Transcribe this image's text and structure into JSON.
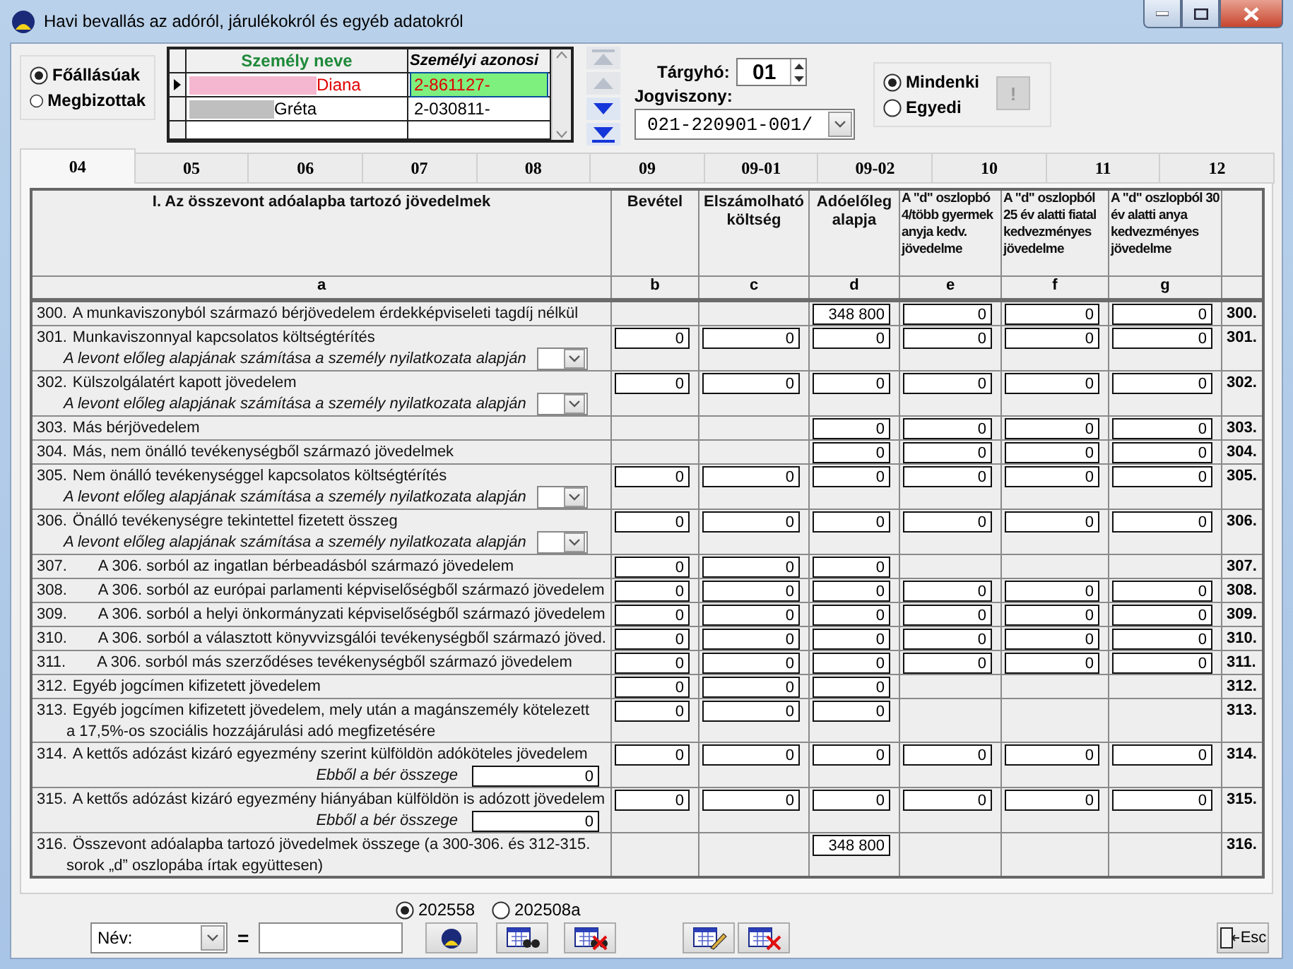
{
  "window": {
    "title": "Havi bevallás az adóról, járulékokról és egyéb adatokról"
  },
  "employment_filter": [
    {
      "label": "Főállásúak",
      "selected": true
    },
    {
      "label": "Megbizottak",
      "selected": false
    }
  ],
  "persons": {
    "columns": [
      "Személy neve",
      "Személyi azonosi"
    ],
    "rows": [
      {
        "name": "Diana",
        "id": "2-861127-",
        "selected": true
      },
      {
        "name": "Gréta",
        "id": "2-030811-",
        "selected": false
      }
    ]
  },
  "navigation": [
    {
      "kind": "first",
      "disabled": true
    },
    {
      "kind": "previous",
      "disabled": true
    },
    {
      "kind": "next",
      "disabled": false
    },
    {
      "kind": "last",
      "disabled": false
    }
  ],
  "period": {
    "label": "Tárgyhó:",
    "value": "01"
  },
  "relation": {
    "label": "Jogviszony:",
    "value": "021-220901-001/"
  },
  "scope": [
    {
      "label": "Mindenki",
      "selected": true
    },
    {
      "label": "Egyedi",
      "selected": false
    }
  ],
  "info_button": {
    "label": "!",
    "disabled": true
  },
  "tabs": [
    {
      "label": "04",
      "selected": true
    },
    {
      "label": "05",
      "selected": false
    },
    {
      "label": "06",
      "selected": false
    },
    {
      "label": "07",
      "selected": false
    },
    {
      "label": "08",
      "selected": false
    },
    {
      "label": "09",
      "selected": false
    },
    {
      "label": "09-01",
      "selected": false
    },
    {
      "label": "09-02",
      "selected": false
    },
    {
      "label": "10",
      "selected": false
    },
    {
      "label": "11",
      "selected": false
    },
    {
      "label": "12",
      "selected": false
    }
  ],
  "table": {
    "columns": [
      {
        "heading": "I. Az összevont adóalapba tartozó jövedelmek",
        "letter": "a"
      },
      {
        "heading": "Bevétel",
        "letter": "b"
      },
      {
        "heading": "Elszámolható költség",
        "letter": "c"
      },
      {
        "heading": "Adóelőleg alapja",
        "letter": "d"
      },
      {
        "heading": "A \"d\" oszlopbó 4/több gyermek anyja kedv. jövedelme",
        "letter": "e"
      },
      {
        "heading": "A \"d\" oszlopból 25 év alatti fiatal kedvezményes jövedelme",
        "letter": "f"
      },
      {
        "heading": "A \"d\" oszlopból 30 év alatti anya kedvezményes jövedelme",
        "letter": "g"
      }
    ],
    "rows": [
      {
        "kind": "main",
        "number": "300.",
        "label": "A munkaviszonyból származó bérjövedelem érdekképviseleti tagdíj nélkül",
        "values": {
          "d": "348 800",
          "e": "0",
          "f": "0",
          "g": "0"
        },
        "end_number": "300."
      },
      {
        "kind": "main",
        "number": "301.",
        "label": "Munkaviszonnyal kapcsolatos költségtérítés",
        "sub": {
          "kind": "dropdown",
          "label": "A levont előleg alapjának számítása a személy nyilatkozata alapján"
        },
        "values": [
          "0",
          "0",
          "0",
          "0",
          "0",
          "0"
        ],
        "end_number": "301."
      },
      {
        "kind": "main",
        "number": "302.",
        "label": "Külszolgálatért kapott jövedelem",
        "sub": {
          "kind": "dropdown",
          "label": "A levont előleg alapjának számítása a személy nyilatkozata alapján"
        },
        "values": [
          "0",
          "0",
          "0",
          "0",
          "0",
          "0"
        ],
        "end_number": "302."
      },
      {
        "kind": "main",
        "number": "303.",
        "label": "Más bérjövedelem",
        "values": {
          "d": "0",
          "e": "0",
          "f": "0",
          "g": "0"
        },
        "end_number": "303."
      },
      {
        "kind": "main",
        "number": "304.",
        "label": "Más, nem önálló tevékenységből származó jövedelmek",
        "values": {
          "d": "0",
          "e": "0",
          "f": "0",
          "g": "0"
        },
        "end_number": "304."
      },
      {
        "kind": "main",
        "number": "305.",
        "label": "Nem önálló tevékenységgel kapcsolatos költségtérítés",
        "sub": {
          "kind": "dropdown",
          "label": "A levont előleg alapjának számítása a személy nyilatkozata alapján"
        },
        "values": [
          "0",
          "0",
          "0",
          "0",
          "0",
          "0"
        ],
        "end_number": "305."
      },
      {
        "kind": "main",
        "number": "306.",
        "label": "Önálló tevékenységre tekintettel fizetett összeg",
        "sub": {
          "kind": "dropdown",
          "label": "A levont előleg alapjának számítása a személy nyilatkozata alapján"
        },
        "values": [
          "0",
          "0",
          "0",
          "0",
          "0",
          "0"
        ],
        "end_number": "306."
      },
      {
        "kind": "detail",
        "number": "307.",
        "label": "A 306. sorból az ingatlan bérbeadásból származó jövedelem",
        "values": {
          "b": "0",
          "c": "0",
          "d": "0"
        },
        "end_number": "307."
      },
      {
        "kind": "detail",
        "number": "308.",
        "label": "A 306. sorból az európai parlamenti képviselőségből származó jövedelem",
        "values": [
          "0",
          "0",
          "0",
          "0",
          "0",
          "0"
        ],
        "end_number": "308."
      },
      {
        "kind": "detail",
        "number": "309.",
        "label": "A 306. sorból a helyi önkormányzati képviselőségből származó jövedelem",
        "values": [
          "0",
          "0",
          "0",
          "0",
          "0",
          "0"
        ],
        "end_number": "309."
      },
      {
        "kind": "detail",
        "number": "310.",
        "label": "A 306. sorból a választott könyvvizsgálói tevékenységből származó jöved.",
        "values": [
          "0",
          "0",
          "0",
          "0",
          "0",
          "0"
        ],
        "end_number": "310."
      },
      {
        "kind": "detail",
        "number": "311.",
        "label": "A 306. sorból más szerződéses tevékenységből származó jövedelem",
        "values": [
          "0",
          "0",
          "0",
          "0",
          "0",
          "0"
        ],
        "end_number": "311."
      },
      {
        "kind": "main",
        "number": "312.",
        "label": "Egyéb jogcímen kifizetett jövedelem",
        "values": {
          "b": "0",
          "c": "0",
          "d": "0"
        },
        "end_number": "312."
      },
      {
        "kind": "main",
        "number": "313.",
        "label": "Egyéb jogcímen kifizetett jövedelem, mely után a magánszemély kötelezett",
        "continuation": "a 17,5%-os szociális hozzájárulási adó megfizetésére",
        "values": {
          "b": "0",
          "c": "0",
          "d": "0"
        },
        "end_number": "313."
      },
      {
        "kind": "main",
        "number": "314.",
        "label": "A kettős adózást kizáró egyezmény szerint külföldön adóköteles jövedelem",
        "sub": {
          "kind": "amount",
          "label": "Ebből a bér összege",
          "value": "0"
        },
        "values": [
          "0",
          "0",
          "0",
          "0",
          "0",
          "0"
        ],
        "end_number": "314."
      },
      {
        "kind": "main",
        "number": "315.",
        "label": "A kettős adózást kizáró egyezmény hiányában külföldön is adózott jövedelem",
        "sub": {
          "kind": "amount",
          "label": "Ebből a bér összege",
          "value": "0"
        },
        "values": [
          "0",
          "0",
          "0",
          "0",
          "0",
          "0"
        ],
        "end_number": "315."
      },
      {
        "kind": "main",
        "number": "316.",
        "label": "Összevont adóalapba tartozó jövedelmek összege (a 300-306. és 312-315.",
        "continuation": "sorok „d” oszlopába írtak együttesen)",
        "values": {
          "d": "348 800"
        },
        "end_number": "316."
      }
    ]
  },
  "versions": [
    {
      "label": "202558",
      "selected": true
    },
    {
      "label": "202508a",
      "selected": false
    }
  ],
  "search": {
    "field": "Név:",
    "operator": "="
  },
  "exit_button": {
    "label": "Esc"
  }
}
